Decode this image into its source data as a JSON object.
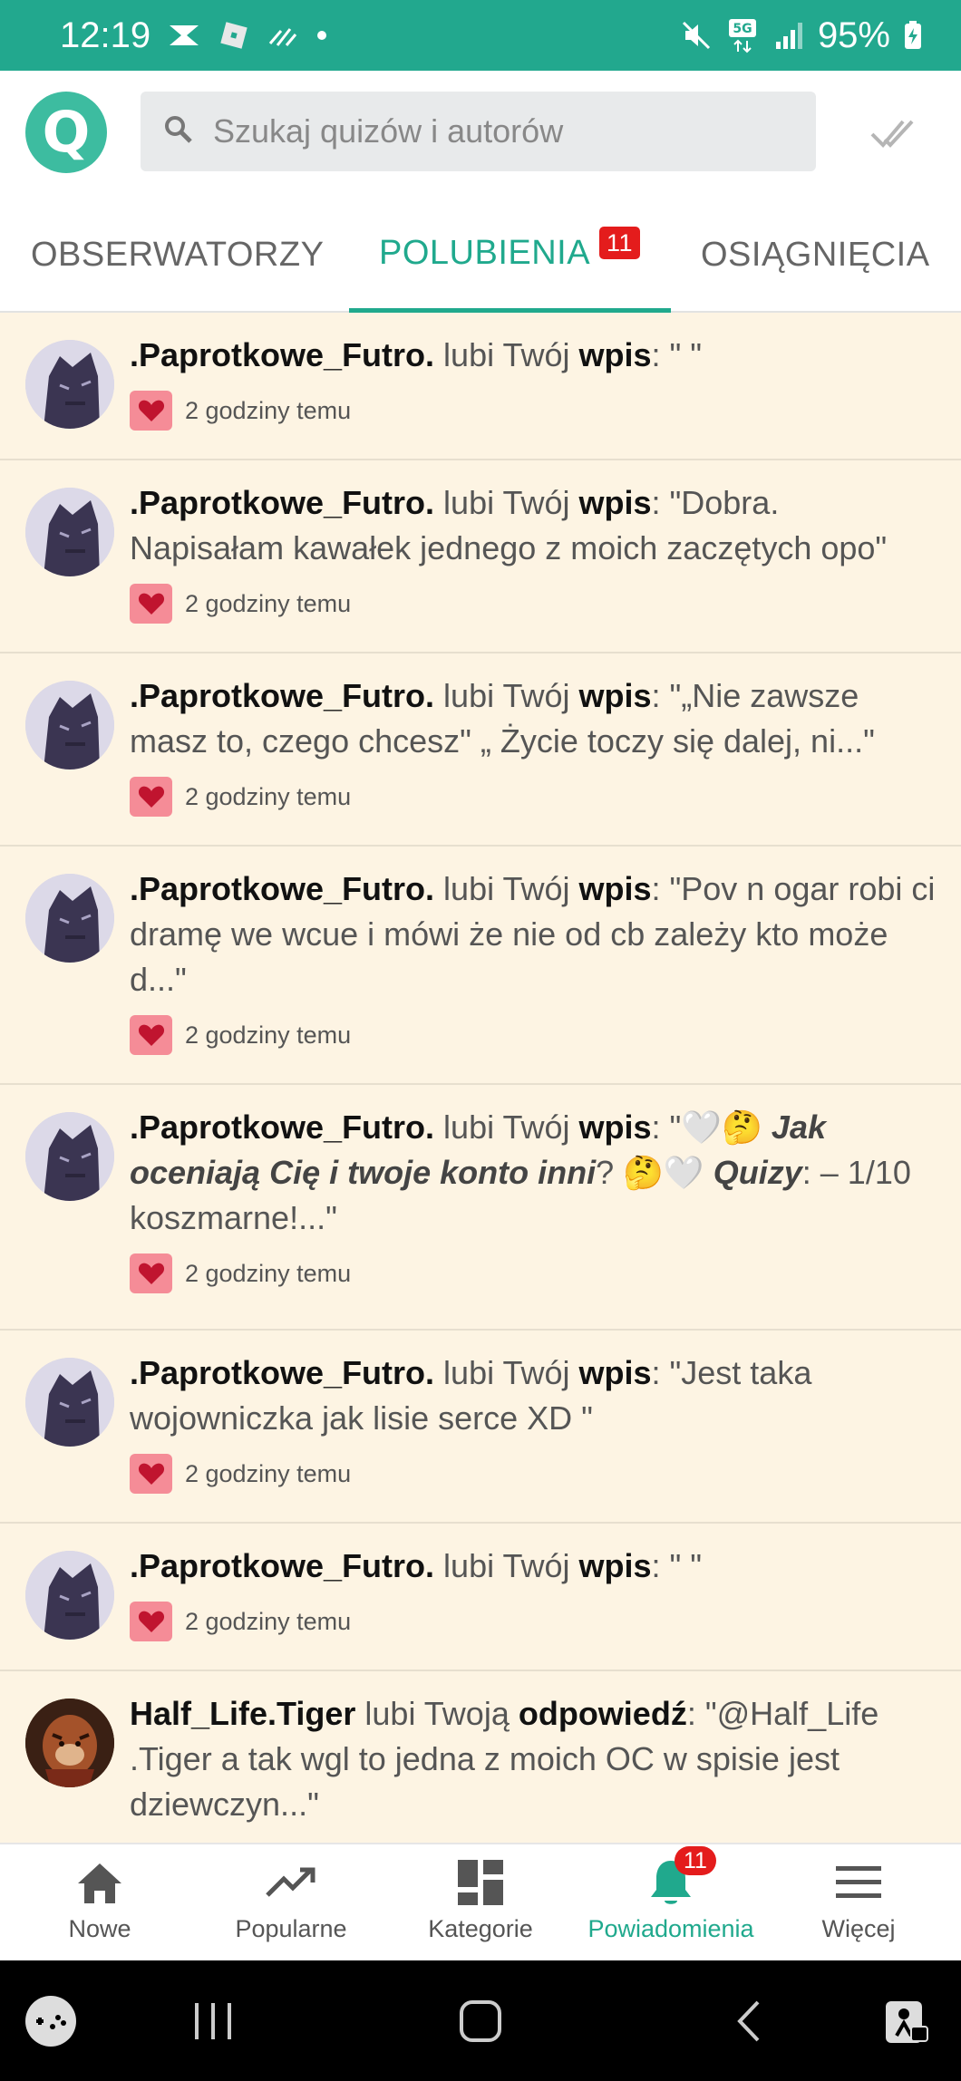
{
  "status_bar": {
    "time": "12:19",
    "battery": "95%",
    "network": "5G"
  },
  "header": {
    "logo_letter": "Q",
    "search_placeholder": "Szukaj quizów i autorów"
  },
  "tabs": [
    {
      "label": "OBSERWATORZY"
    },
    {
      "label": "POLUBIENIA",
      "badge": "11"
    },
    {
      "label": "OSIĄGNIĘCIA"
    }
  ],
  "notifications": [
    {
      "user": ".Paprotkowe_Futro.",
      "action": " lubi Twój ",
      "object": "wpis",
      "quote": ": \" \"",
      "time": "2 godziny temu"
    },
    {
      "user": ".Paprotkowe_Futro.",
      "action": " lubi Twój ",
      "object": "wpis",
      "quote": ": \"Dobra. Napisałam kawałek jednego z moich zaczętych opo\"",
      "time": "2 godziny temu"
    },
    {
      "user": ".Paprotkowe_Futro.",
      "action": " lubi Twój ",
      "object": "wpis",
      "quote": ": \"„Nie zawsze masz to, czego chcesz\" „ Życie toczy się dalej, ni...\"",
      "time": "2 godziny temu"
    },
    {
      "user": ".Paprotkowe_Futro.",
      "action": " lubi Twój ",
      "object": "wpis",
      "quote": ": \"Pov n ogar robi ci dramę we wcue i mówi że nie od cb zależy kto może d...\"",
      "time": "2 godziny temu"
    },
    {
      "user": ".Paprotkowe_Futro.",
      "action": " lubi Twój ",
      "object": "wpis",
      "quote_pre": ": \"🤍🤔 ",
      "quote_em1": "Jak oceniają Cię i twoje konto inni",
      "quote_mid": "? 🤔🤍 ",
      "quote_em2": "Quizy",
      "quote_post": ": – 1/10 koszmarne!...\"",
      "time": "2 godziny temu"
    },
    {
      "user": ".Paprotkowe_Futro.",
      "action": " lubi Twój ",
      "object": "wpis",
      "quote": ": \"Jest taka wojowniczka jak lisie serce XD \"",
      "time": "2 godziny temu"
    },
    {
      "user": ".Paprotkowe_Futro.",
      "action": " lubi Twój ",
      "object": "wpis",
      "quote": ": \" \"",
      "time": "2 godziny temu"
    },
    {
      "user": "Half_Life.Tiger",
      "action": " lubi Twoją ",
      "object": "odpowiedź",
      "quote": ": \"@Half_Life .Tiger a tak wgl to jedna z moich OC w spisie jest dziewczyn...\""
    }
  ],
  "bottom_nav": [
    {
      "label": "Nowe",
      "icon": "home-icon"
    },
    {
      "label": "Popularne",
      "icon": "trending-icon"
    },
    {
      "label": "Kategorie",
      "icon": "grid-icon"
    },
    {
      "label": "Powiadomienia",
      "icon": "bell-icon",
      "badge": "11"
    },
    {
      "label": "Więcej",
      "icon": "menu-icon"
    }
  ],
  "colors": {
    "accent": "#20a98d",
    "status_bar": "#22a88e",
    "list_bg": "#fdf4e3",
    "heart": "#f58c97",
    "badge": "#e41c1c"
  }
}
